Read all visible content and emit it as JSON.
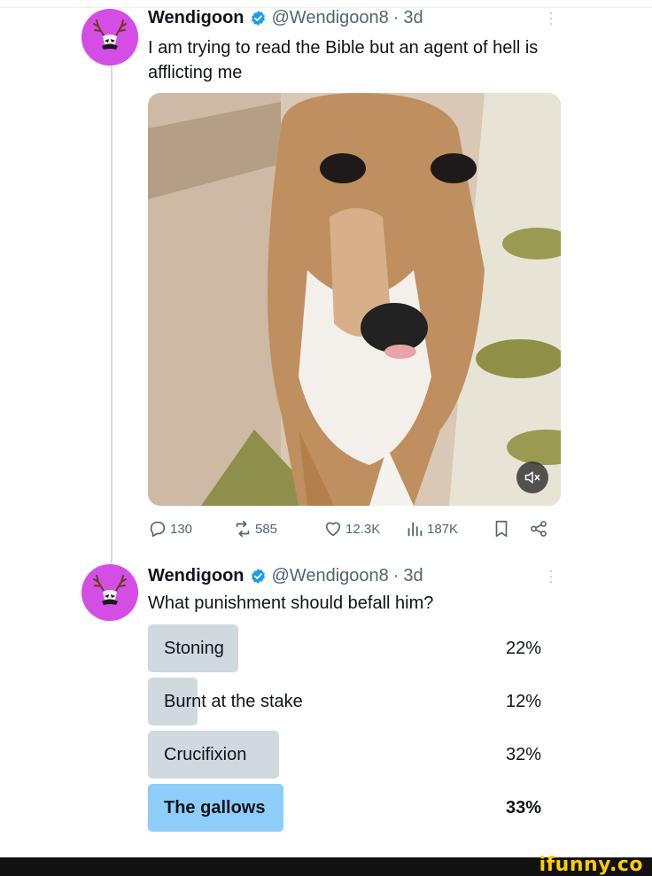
{
  "colors": {
    "verified_badge": "#1d9bf0",
    "avatar_bg": "#d44ee6",
    "poll_bar": "#cfd9de",
    "poll_winner_bar": "#8ecdf8",
    "brand": "#ffcc00"
  },
  "icons": {
    "verified": "verified-badge-icon",
    "mute": "volume-muted-icon",
    "reply": "reply-icon",
    "repost": "repost-icon",
    "like": "heart-icon",
    "views": "analytics-icon",
    "bookmark": "bookmark-icon",
    "share": "share-icon"
  },
  "tweet1": {
    "name": "Wendigoon",
    "handle": "@Wendigoon8",
    "separator": "·",
    "time": "3d",
    "text": "I am trying to read the Bible but an agent of hell is afflicting me",
    "stats": {
      "replies": "130",
      "reposts": "585",
      "likes": "12.3K",
      "views": "187K"
    }
  },
  "tweet2": {
    "name": "Wendigoon",
    "handle": "@Wendigoon8",
    "separator": "·",
    "time": "3d",
    "text": "What punishment should befall him?",
    "poll": [
      {
        "label": "Stoning",
        "percent": "22%",
        "fraction": 0.22,
        "winner": false
      },
      {
        "label": "Burnt at the stake",
        "percent": "12%",
        "fraction": 0.12,
        "winner": false
      },
      {
        "label": "Crucifixion",
        "percent": "32%",
        "fraction": 0.32,
        "winner": false
      },
      {
        "label": "The gallows",
        "percent": "33%",
        "fraction": 0.33,
        "winner": true
      }
    ]
  },
  "watermark": "ifunny.co"
}
